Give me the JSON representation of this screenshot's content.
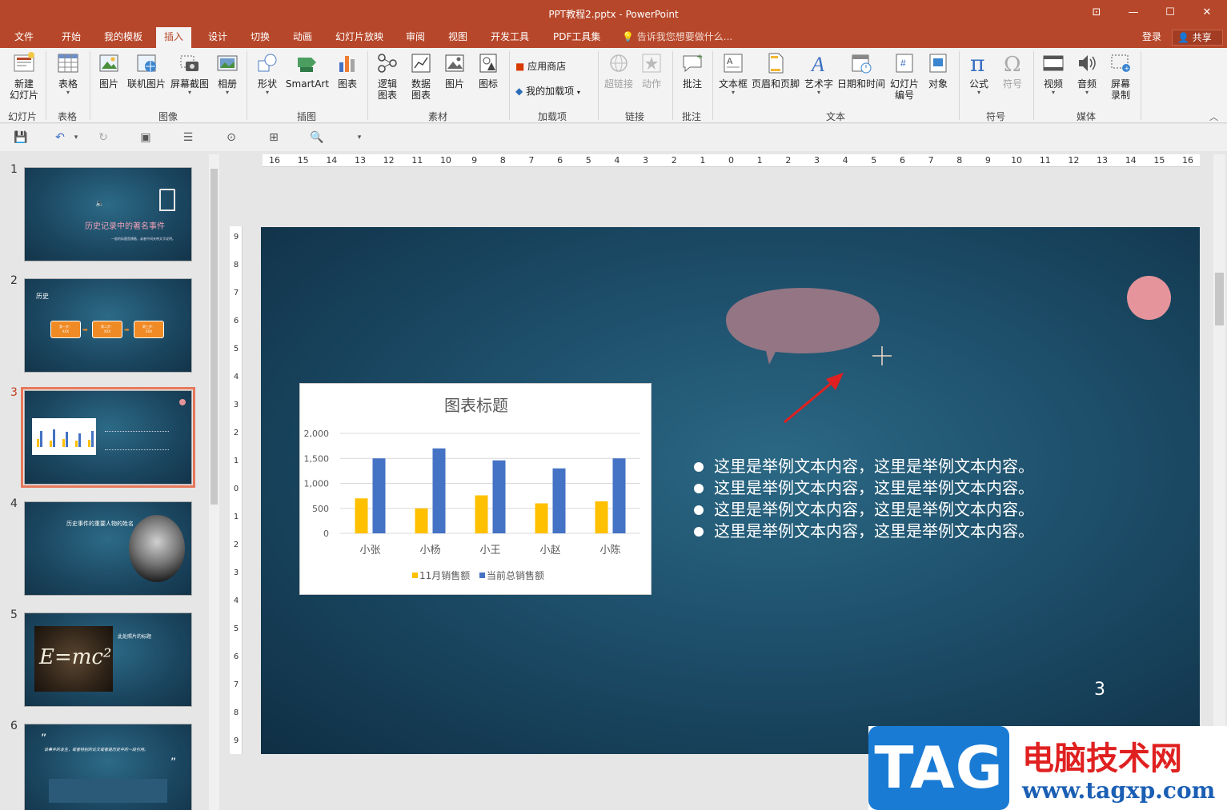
{
  "window": {
    "title": "PPT教程2.pptx - PowerPoint",
    "controls": [
      "restore-ribbon",
      "minimize",
      "maximize",
      "close"
    ]
  },
  "menu": {
    "tabs": [
      "文件",
      "开始",
      "我的模板",
      "插入",
      "设计",
      "切换",
      "动画",
      "幻灯片放映",
      "审阅",
      "视图",
      "开发工具",
      "PDF工具集"
    ],
    "active_tab": "插入",
    "tell_me": "告诉我您想要做什么...",
    "login": "登录",
    "share": "共享"
  },
  "ribbon": {
    "buttons": {
      "new_slide": "新建\n幻灯片",
      "table": "表格",
      "picture": "图片",
      "online_picture": "联机图片",
      "screenshot": "屏幕截图",
      "album": "相册",
      "shapes": "形状",
      "smartart": "SmartArt",
      "chart": "图表",
      "logic_chart": "逻辑\n图表",
      "data_chart": "数据\n图表",
      "material_picture": "图片",
      "icon": "图标",
      "app_store": "应用商店",
      "my_addins": "我的加载项",
      "hyperlink": "超链接",
      "action": "动作",
      "comment": "批注",
      "textbox": "文本框",
      "header_footer": "页眉和页脚",
      "wordart": "艺术字",
      "datetime": "日期和时间",
      "slide_number": "幻灯片\n编号",
      "object": "对象",
      "equation": "公式",
      "symbol": "符号",
      "video": "视频",
      "audio": "音频",
      "screen_record": "屏幕\n录制"
    },
    "groups": {
      "slides": "幻灯片",
      "tables": "表格",
      "images": "图像",
      "illustrations": "插图",
      "material": "素材",
      "addins": "加载项",
      "links": "链接",
      "comments": "批注",
      "text": "文本",
      "symbols": "符号",
      "media": "媒体"
    }
  },
  "thumbnails": {
    "numbers": [
      "1",
      "2",
      "3",
      "4",
      "5",
      "6"
    ],
    "active": "3",
    "slide1_title": "历史记录中的著名事件",
    "slide1_sub": "一般的标题是横着，或者中间夹带文字说明。",
    "slide2_title": "历史",
    "slide2_steps": [
      "第一步：\nXXX",
      "第二步：\nXXX",
      "第三步：\nXXX"
    ],
    "slide4_title": "历史事件的重要人物的姓名",
    "slide5_title": "此处照片的标题",
    "slide5_formula": "E=mc²",
    "slide6_quote": "该事件的发生，或者特别的论文或者是历史中的一段引用。"
  },
  "ruler": {
    "h_ticks": [
      "16",
      "15",
      "14",
      "13",
      "12",
      "11",
      "10",
      "9",
      "8",
      "7",
      "6",
      "5",
      "4",
      "3",
      "2",
      "1",
      "0",
      "1",
      "2",
      "3",
      "4",
      "5",
      "6",
      "7",
      "8",
      "9",
      "10",
      "11",
      "12",
      "13",
      "14",
      "15",
      "16"
    ],
    "v_ticks": [
      "9",
      "8",
      "7",
      "6",
      "5",
      "4",
      "3",
      "2",
      "1",
      "0",
      "1",
      "2",
      "3",
      "4",
      "5",
      "6",
      "7",
      "8",
      "9"
    ]
  },
  "slide": {
    "bullets": [
      "这里是举例文本内容，这里是举例文本内容。",
      "这里是举例文本内容，这里是举例文本内容。",
      "这里是举例文本内容，这里是举例文本内容。",
      "这里是举例文本内容，这里是举例文本内容。"
    ],
    "page_number": "3",
    "callout_color": "#937583",
    "circle_color": "#e5949c",
    "arrow_color": "#e02020"
  },
  "chart_data": {
    "type": "bar",
    "title": "图表标题",
    "categories": [
      "小张",
      "小杨",
      "小王",
      "小赵",
      "小陈"
    ],
    "series": [
      {
        "name": "11月销售额",
        "color": "#ffc000",
        "values": [
          700,
          500,
          760,
          600,
          640
        ]
      },
      {
        "name": "当前总销售额",
        "color": "#4472c4",
        "values": [
          1500,
          1700,
          1460,
          1300,
          1500
        ]
      }
    ],
    "ylim": [
      0,
      2000
    ],
    "yticks": [
      "0",
      "500",
      "1,000",
      "1,500",
      "2,000"
    ],
    "ytick_values": [
      0,
      500,
      1000,
      1500,
      2000
    ],
    "grid": true,
    "legend": "bottom"
  },
  "watermark": {
    "tag": "TAG",
    "cn": "电脑技术网",
    "url": "www.tagxp.com"
  }
}
